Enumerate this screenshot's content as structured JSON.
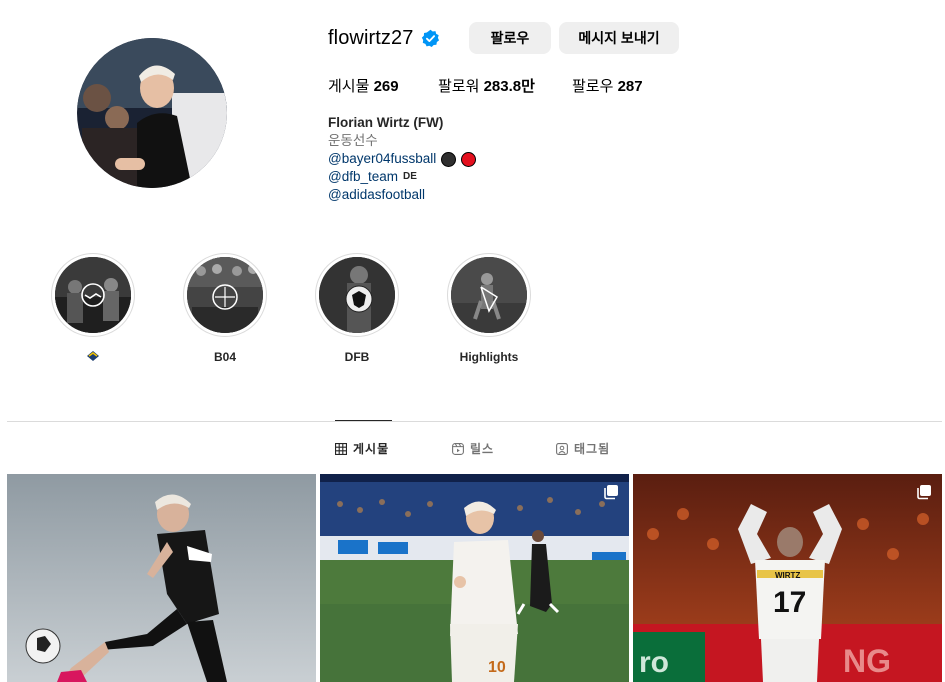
{
  "profile": {
    "username": "flowirtz27",
    "verified": true,
    "follow_label": "팔로우",
    "message_label": "메시지 보내기",
    "stats": {
      "posts_label": "게시물",
      "posts_count": "269",
      "followers_label": "팔로워",
      "followers_count": "283.8만",
      "following_label": "팔로우",
      "following_count": "287"
    },
    "bio": {
      "name": "Florian Wirtz (FW)",
      "category": "운동선수",
      "links": [
        {
          "text": "@bayer04fussball",
          "badges": [
            "#2f2f2f",
            "#e4101e"
          ]
        },
        {
          "text": "@dfb_team",
          "flag_text": "DE"
        },
        {
          "text": "@adidasfootball"
        }
      ]
    }
  },
  "highlights": [
    {
      "label": "",
      "label_icon": "handshake-emoji-icon"
    },
    {
      "label": "B04"
    },
    {
      "label": "DFB"
    },
    {
      "label": "Highlights"
    }
  ],
  "tabs": [
    {
      "label": "게시물",
      "icon": "grid-icon",
      "active": true
    },
    {
      "label": "릴스",
      "icon": "reels-icon",
      "active": false
    },
    {
      "label": "태그됨",
      "icon": "tagged-icon",
      "active": false
    }
  ],
  "posts": [
    {
      "type": "photo",
      "multi": false
    },
    {
      "type": "photo",
      "multi": true
    },
    {
      "type": "photo",
      "multi": true
    }
  ],
  "colors": {
    "verified_blue": "#0095f6",
    "link": "#00376b",
    "button_bg": "#efefef"
  }
}
